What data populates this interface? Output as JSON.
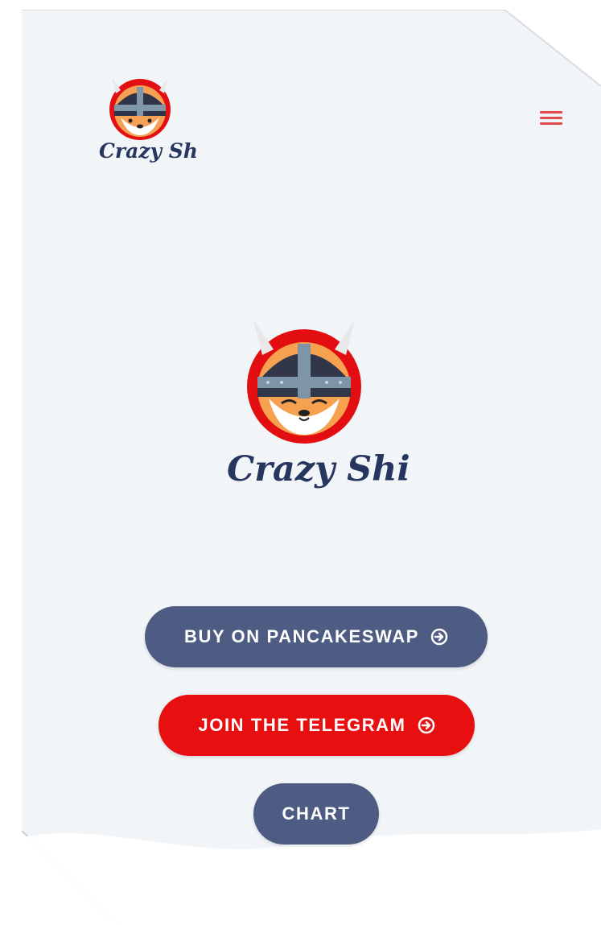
{
  "brand": {
    "name": "Crazy Shiba"
  },
  "header": {
    "menu_icon": "hamburger-menu-icon"
  },
  "buttons": {
    "buy_label": "BUY ON PANCAKESWAP",
    "telegram_label": "JOIN THE TELEGRAM",
    "chart_label": "CHART",
    "arrow_icon": "circle-arrow-right-icon"
  },
  "colors": {
    "background": "#f2f5f8",
    "slate": "#4e5c83",
    "red": "#e80f11",
    "brand_navy": "#26365f",
    "menu_red": "#e34b4b"
  }
}
